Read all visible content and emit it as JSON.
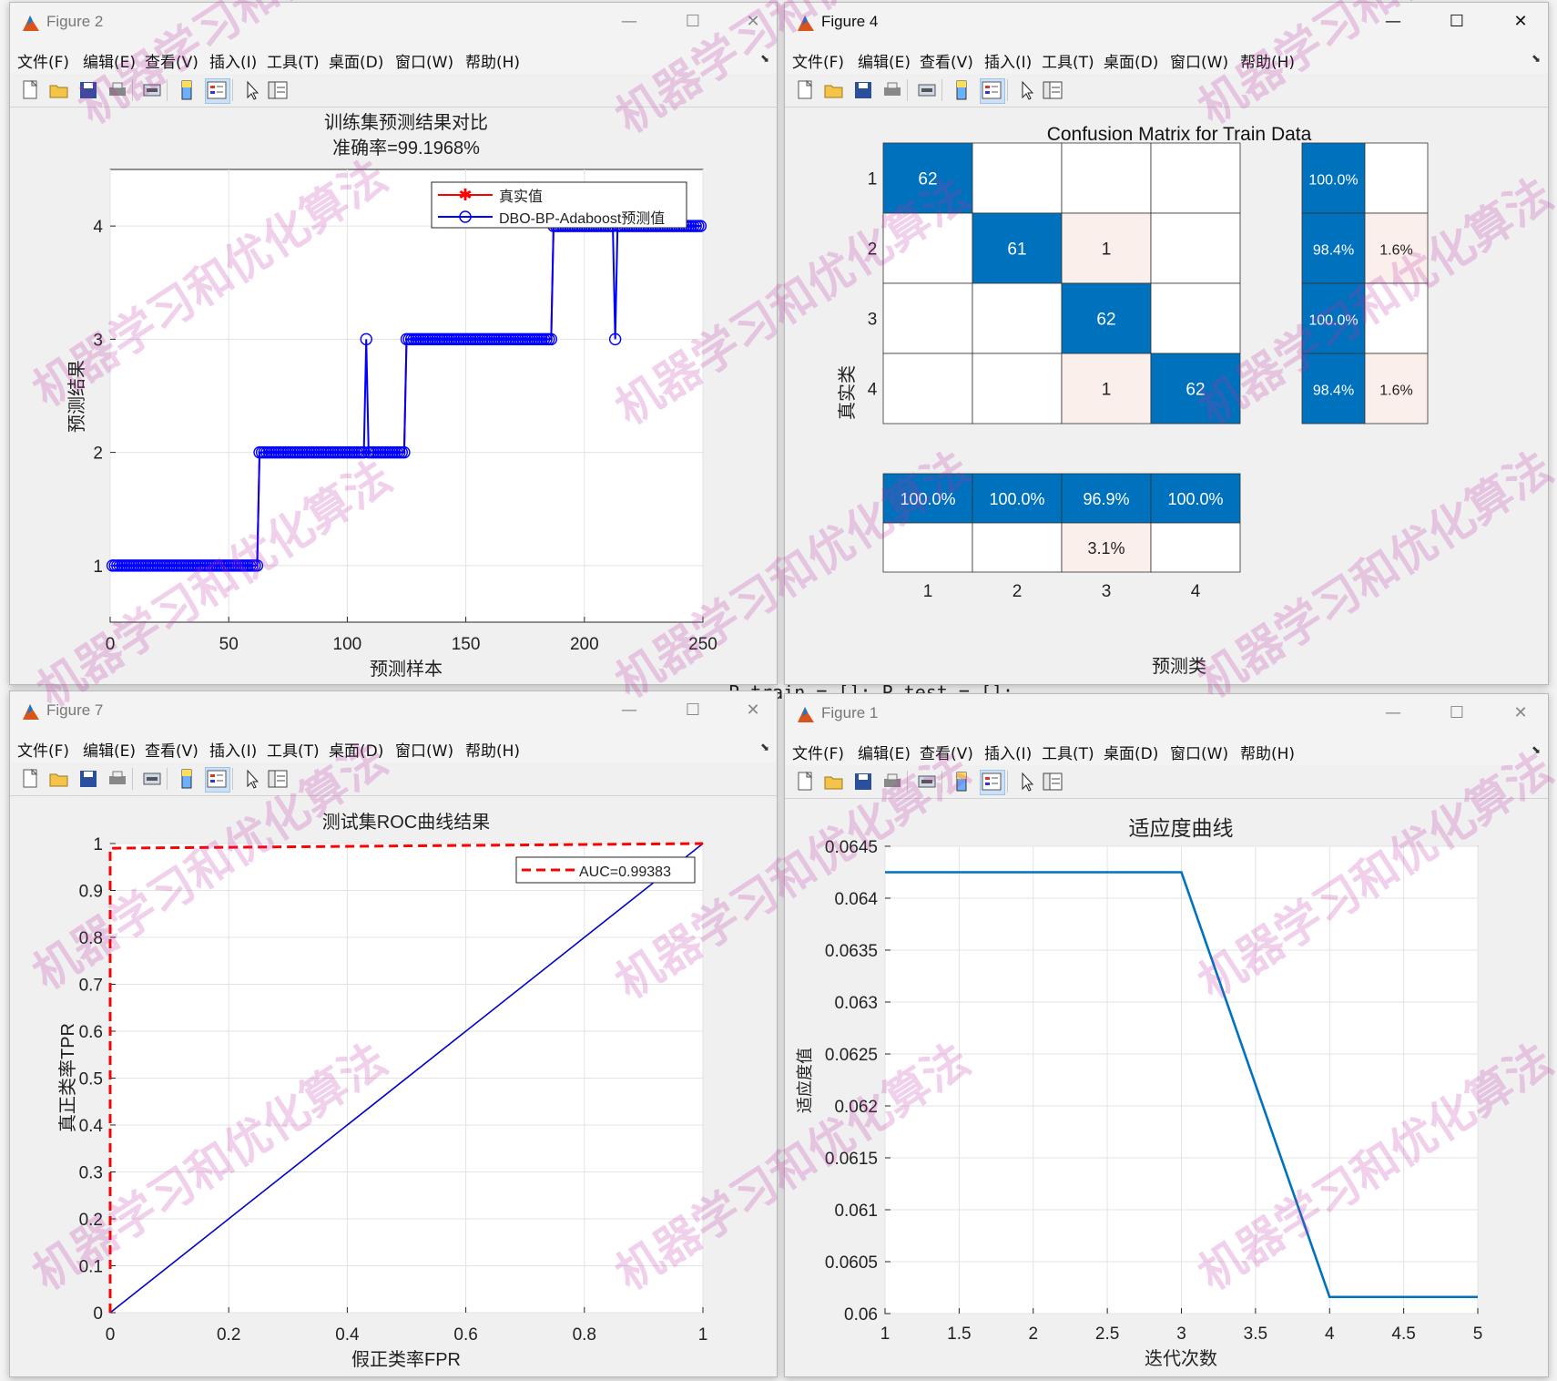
{
  "menu": [
    "文件(F)",
    "编辑(E)",
    "查看(V)",
    "插入(I)",
    "工具(T)",
    "桌面(D)",
    "窗口(W)",
    "帮助(H)"
  ],
  "background": {
    "code_text": "P_train = []; P_test = [];"
  },
  "watermark": "机器学习和优化算法",
  "colors": {
    "blue": "#0000ff",
    "red": "#ff0000",
    "matlab_blue": "#0072bd",
    "cm_blue": "#0072bd",
    "cm_pink": "#fbefeb"
  },
  "windows": {
    "fig2": {
      "title": "Figure 2",
      "chart_data": {
        "type": "line",
        "title": "训练集预测结果对比",
        "subtitle": "准确率=99.1968%",
        "xlabel": "预测样本",
        "ylabel": "预测结果",
        "xlim": [
          0,
          250
        ],
        "ylim": [
          0.5,
          4.5
        ],
        "xticks": [
          "0",
          "50",
          "100",
          "150",
          "200",
          "250"
        ],
        "yticks": [
          "1",
          "2",
          "3",
          "4"
        ],
        "grid": true,
        "legend_position": "top-right",
        "series": [
          {
            "name": "真实值",
            "segments": [
              {
                "x": [
                  1,
                  62
                ],
                "y": 1
              },
              {
                "x": [
                  63,
                  124
                ],
                "y": 2
              },
              {
                "x": [
                  125,
                  186
                ],
                "y": 3
              },
              {
                "x": [
                  187,
                  249
                ],
                "y": 4
              }
            ]
          },
          {
            "name": "DBO-BP-Adaboost预测值",
            "outliers": [
              {
                "x": 108,
                "y": 3
              },
              {
                "x": 213,
                "y": 3
              }
            ]
          }
        ]
      }
    },
    "fig4": {
      "title": "Figure 4",
      "chart_data": {
        "type": "heatmap",
        "title": "Confusion Matrix for Train Data",
        "xlabel": "预测类",
        "ylabel": "真实类",
        "labels": [
          "1",
          "2",
          "3",
          "4"
        ],
        "matrix": [
          [
            "62",
            "",
            "",
            ""
          ],
          [
            "",
            "61",
            "1",
            ""
          ],
          [
            "",
            "",
            "62",
            ""
          ],
          [
            "",
            "",
            "1",
            "62"
          ]
        ],
        "row_summary": [
          [
            "100.0%",
            ""
          ],
          [
            "98.4%",
            "1.6%"
          ],
          [
            "100.0%",
            ""
          ],
          [
            "98.4%",
            "1.6%"
          ]
        ],
        "col_summary": [
          [
            "100.0%",
            ""
          ],
          [
            "100.0%",
            ""
          ],
          [
            "96.9%",
            "3.1%"
          ],
          [
            "100.0%",
            ""
          ]
        ]
      }
    },
    "fig7": {
      "title": "Figure 7",
      "chart_data": {
        "type": "line",
        "title": "测试集ROC曲线结果",
        "xlabel": "假正类率FPR",
        "ylabel": "真正类率TPR",
        "xlim": [
          0,
          1
        ],
        "ylim": [
          0,
          1
        ],
        "xticks": [
          "0",
          "0.2",
          "0.4",
          "0.6",
          "0.8",
          "1"
        ],
        "yticks": [
          "0",
          "0.1",
          "0.2",
          "0.3",
          "0.4",
          "0.5",
          "0.6",
          "0.7",
          "0.8",
          "0.9",
          "1"
        ],
        "grid": true,
        "legend_position": "top-right",
        "series": [
          {
            "name": "AUC=0.99383",
            "x": [
              0,
              0,
              0,
              0.0,
              1
            ],
            "y": [
              0,
              0.5,
              0.99,
              0.99,
              1
            ]
          },
          {
            "x": [
              0,
              1
            ],
            "y": [
              0,
              1
            ]
          }
        ]
      }
    },
    "fig1": {
      "title": "Figure 1",
      "chart_data": {
        "type": "line",
        "title": "适应度曲线",
        "xlabel": "迭代次数",
        "ylabel": "适应度值",
        "xlim": [
          1,
          5
        ],
        "ylim": [
          0.06,
          0.0645
        ],
        "xticks": [
          "1",
          "1.5",
          "2",
          "2.5",
          "3",
          "3.5",
          "4",
          "4.5",
          "5"
        ],
        "yticks": [
          "0.06",
          "0.0605",
          "0.061",
          "0.0615",
          "0.062",
          "0.0625",
          "0.063",
          "0.0635",
          "0.064",
          "0.0645"
        ],
        "grid": true,
        "series": [
          {
            "x": [
              1,
              2,
              3,
              4,
              5
            ],
            "y": [
              0.06425,
              0.06425,
              0.06425,
              0.06016,
              0.06016
            ]
          }
        ]
      }
    }
  }
}
